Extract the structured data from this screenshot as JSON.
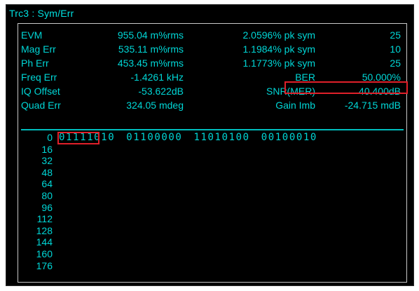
{
  "trace_title": "Trc3 : Sym/Err",
  "measurements": [
    {
      "label": "EVM",
      "value1": "955.04 m%rms",
      "value2": "2.0596% pk sym",
      "value3": "25"
    },
    {
      "label": "Mag Err",
      "value1": "535.11 m%rms",
      "value2": "1.1984% pk sym",
      "value3": "10"
    },
    {
      "label": "Ph Err",
      "value1": "453.45 m%rms",
      "value2": "1.1773% pk sym",
      "value3": "25"
    },
    {
      "label": "Freq Err",
      "value1": "-1.4261 kHz",
      "value2": "BER",
      "value3": "50.000%"
    },
    {
      "label": "IQ Offset",
      "value1": "-53.622dB",
      "value2": "SNR(MER)",
      "value3": "40.400dB"
    },
    {
      "label": "Quad Err",
      "value1": "324.05 mdeg",
      "value2": "Gain Imb",
      "value3": "-24.715 mdB"
    }
  ],
  "bits": {
    "rows": [
      {
        "index": "0",
        "groups": [
          "01111010",
          "01100000",
          "11010100",
          "00100010"
        ]
      },
      {
        "index": "16",
        "groups": []
      },
      {
        "index": "32",
        "groups": []
      },
      {
        "index": "48",
        "groups": []
      },
      {
        "index": "64",
        "groups": []
      },
      {
        "index": "80",
        "groups": []
      },
      {
        "index": "96",
        "groups": []
      },
      {
        "index": "112",
        "groups": []
      },
      {
        "index": "128",
        "groups": []
      },
      {
        "index": "144",
        "groups": []
      },
      {
        "index": "160",
        "groups": []
      },
      {
        "index": "176",
        "groups": []
      }
    ]
  },
  "colors": {
    "text": "#00d6d6",
    "background": "#000000",
    "highlight": "#e0202a"
  }
}
